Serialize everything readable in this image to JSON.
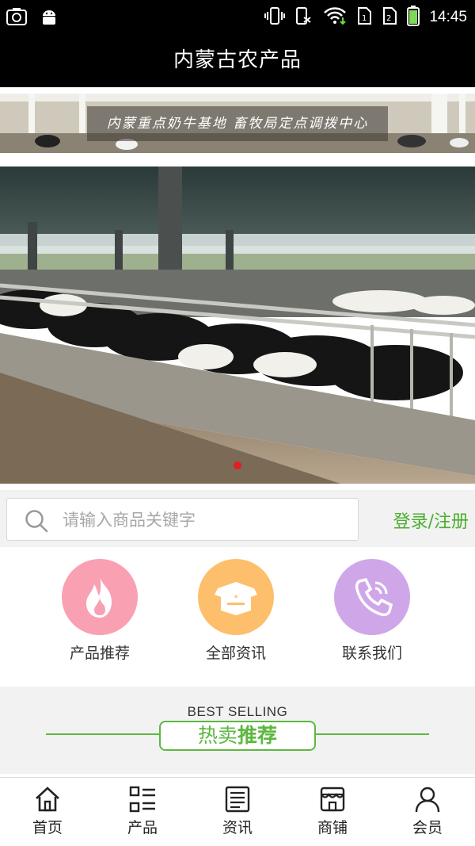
{
  "status_bar": {
    "time": "14:45",
    "left_icons": [
      "screenshot-icon",
      "android-icon"
    ],
    "right_icons": [
      "vibrate-icon",
      "phone-muted-icon",
      "wifi-icon",
      "sim1-icon",
      "sim2-icon",
      "battery-icon"
    ]
  },
  "header": {
    "title": "内蒙古农产品"
  },
  "banner_top": {
    "slogan": "内蒙重点奶牛基地 畜牧局定点调拨中心"
  },
  "hero": {
    "image": "dairy-cow-barn-photo",
    "slide_count": 1,
    "active_slide": 1,
    "indicator_color": "#e02020"
  },
  "search": {
    "placeholder": "请输入商品关键字",
    "value": "",
    "login_label": "登录/注册"
  },
  "quick_nav": [
    {
      "label": "产品推荐",
      "icon": "flame-icon",
      "color": "#f9a0b3"
    },
    {
      "label": "全部资讯",
      "icon": "box-icon",
      "color": "#fdbf6b"
    },
    {
      "label": "联系我们",
      "icon": "phone-icon",
      "color": "#cfa7e9"
    }
  ],
  "best_selling": {
    "en": "BEST SELLING",
    "cn_normal": "热卖",
    "cn_bold": "推荐",
    "accent": "#5cb840"
  },
  "tabbar": [
    {
      "label": "首页",
      "icon": "home-icon"
    },
    {
      "label": "产品",
      "icon": "grid-list-icon"
    },
    {
      "label": "资讯",
      "icon": "news-icon"
    },
    {
      "label": "商铺",
      "icon": "store-icon"
    },
    {
      "label": "会员",
      "icon": "user-icon"
    }
  ],
  "colors": {
    "accent_green": "#4cae2d",
    "header_bg": "#000000"
  }
}
